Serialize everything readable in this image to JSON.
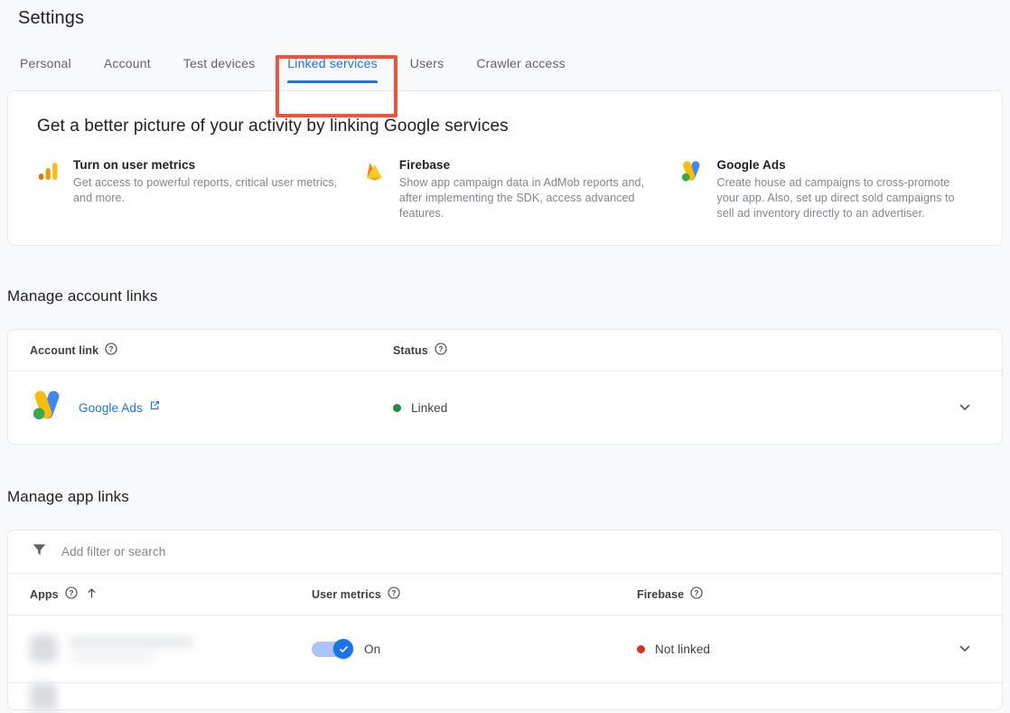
{
  "page": {
    "title": "Settings"
  },
  "tabs": [
    {
      "label": "Personal",
      "active": false
    },
    {
      "label": "Account",
      "active": false
    },
    {
      "label": "Test devices",
      "active": false
    },
    {
      "label": "Linked services",
      "active": true
    },
    {
      "label": "Users",
      "active": false
    },
    {
      "label": "Crawler access",
      "active": false
    }
  ],
  "promo": {
    "heading": "Get a better picture of your activity by linking Google services",
    "items": [
      {
        "icon": "user-metrics-bar-chart-icon",
        "title": "Turn on user metrics",
        "description": "Get access to powerful reports, critical user metrics, and more."
      },
      {
        "icon": "firebase-flame-icon",
        "title": "Firebase",
        "description": "Show app campaign data in AdMob reports and, after implementing the SDK, access advanced features."
      },
      {
        "icon": "google-ads-icon",
        "title": "Google Ads",
        "description": "Create house ad campaigns to cross-promote your app. Also, set up direct sold campaigns to sell ad inventory directly to an advertiser."
      }
    ]
  },
  "account_links": {
    "section_title": "Manage account links",
    "columns": [
      {
        "label": "Account link",
        "help": true
      },
      {
        "label": "Status",
        "help": true
      }
    ],
    "rows": [
      {
        "icon": "google-ads-icon",
        "name": "Google Ads",
        "external_link": true,
        "status": "Linked",
        "status_color": "#1e8e3e"
      }
    ]
  },
  "app_links": {
    "section_title": "Manage app links",
    "filter": {
      "icon": "filter-funnel-icon",
      "placeholder": "Add filter or search",
      "value": ""
    },
    "columns": [
      {
        "label": "Apps",
        "help": true,
        "sorted": "ascending"
      },
      {
        "label": "User metrics",
        "help": true
      },
      {
        "label": "Firebase",
        "help": true
      }
    ],
    "rows": [
      {
        "app_name": "",
        "redacted": true,
        "user_metrics": {
          "enabled": true,
          "label": "On"
        },
        "firebase_status": "Not linked",
        "firebase_status_color": "#d93025"
      }
    ]
  },
  "colors": {
    "accent_blue": "#1a73e8",
    "page_background": "#f8f9fa",
    "card_background": "#ffffff",
    "annotation_red": "#f4513b",
    "status_linked_green": "#1e8e3e",
    "status_not_linked_red": "#d93025"
  }
}
